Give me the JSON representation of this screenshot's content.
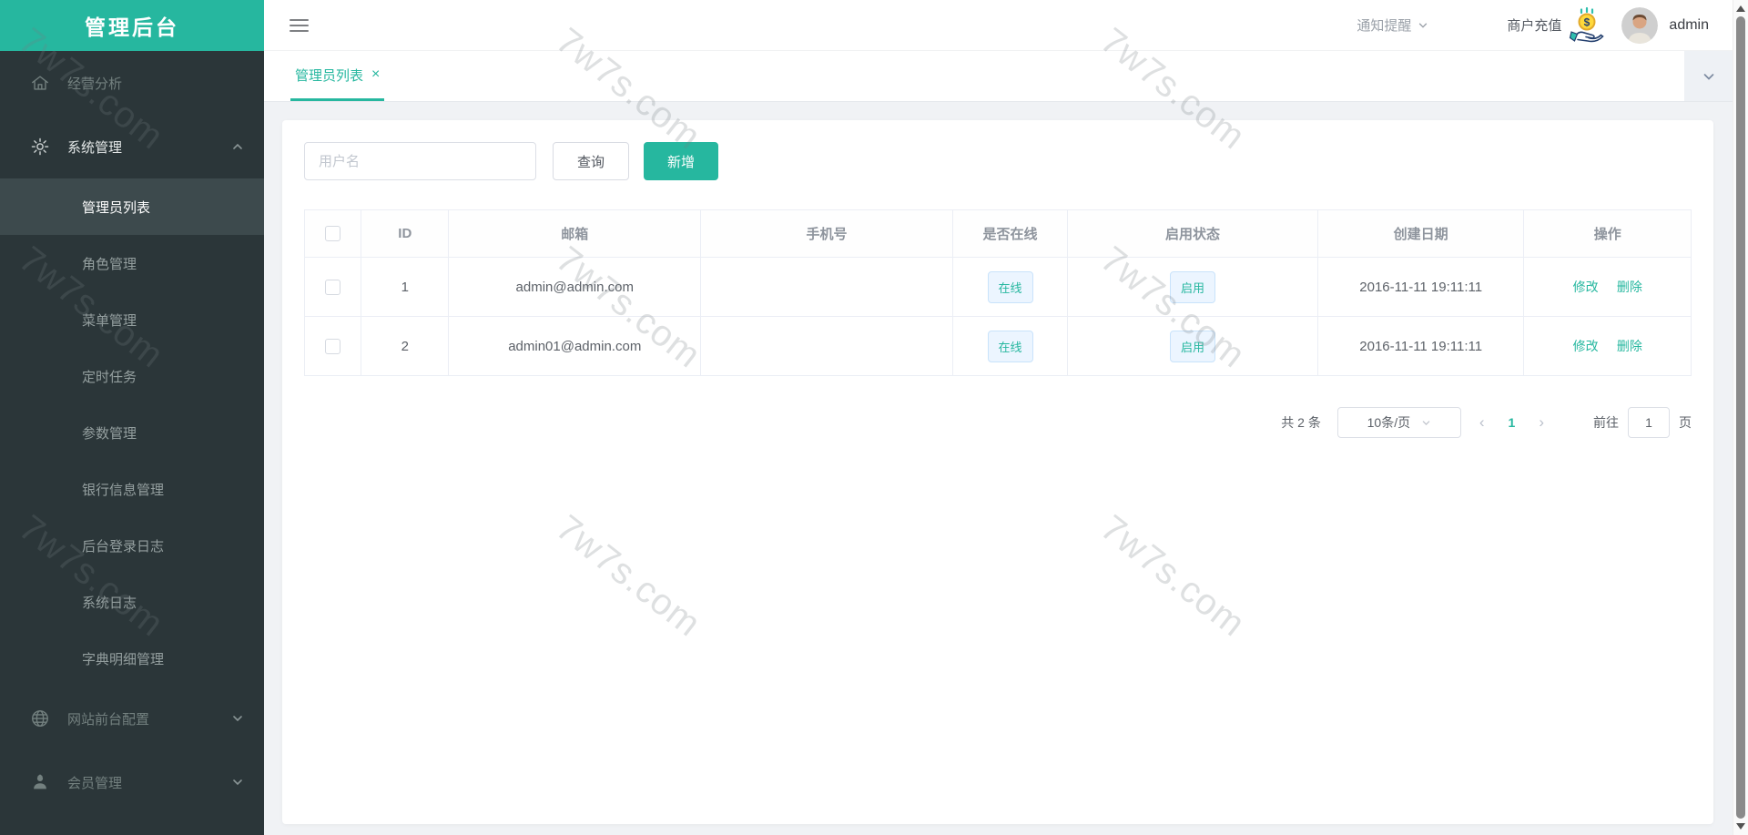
{
  "app": {
    "title": "管理后台"
  },
  "header": {
    "notice_label": "通知提醒",
    "recharge_label": "商户充值",
    "username": "admin"
  },
  "sidebar": {
    "items": [
      {
        "label": "经营分析",
        "icon": "home-icon"
      },
      {
        "label": "系统管理",
        "icon": "gear-icon",
        "expanded": true,
        "children": [
          {
            "label": "管理员列表",
            "active": true
          },
          {
            "label": "角色管理"
          },
          {
            "label": "菜单管理"
          },
          {
            "label": "定时任务"
          },
          {
            "label": "参数管理"
          },
          {
            "label": "银行信息管理"
          },
          {
            "label": "后台登录日志"
          },
          {
            "label": "系统日志"
          },
          {
            "label": "字典明细管理"
          }
        ]
      },
      {
        "label": "网站前台配置",
        "icon": "globe-icon",
        "expanded": false
      },
      {
        "label": "会员管理",
        "icon": "member-icon",
        "expanded": false
      }
    ]
  },
  "tabs": {
    "active_label": "管理员列表",
    "close_glyph": "×"
  },
  "toolbar": {
    "search_placeholder": "用户名",
    "search_value": "",
    "query_label": "查询",
    "add_label": "新增"
  },
  "table": {
    "headers": [
      "ID",
      "邮箱",
      "手机号",
      "是否在线",
      "启用状态",
      "创建日期",
      "操作"
    ],
    "rows": [
      {
        "id": "1",
        "email": "admin@admin.com",
        "phone": "",
        "online_label": "在线",
        "status_label": "启用",
        "created": "2016-11-11 19:11:11",
        "edit_label": "修改",
        "delete_label": "删除"
      },
      {
        "id": "2",
        "email": "admin01@admin.com",
        "phone": "",
        "online_label": "在线",
        "status_label": "启用",
        "created": "2016-11-11 19:11:11",
        "edit_label": "修改",
        "delete_label": "删除"
      }
    ]
  },
  "pagination": {
    "total_label": "共 2 条",
    "page_size": "10条/页",
    "current_page": "1",
    "goto_label": "前往",
    "goto_value": "1",
    "page_unit": "页"
  },
  "watermark": {
    "text": "7w7s.com"
  },
  "colors": {
    "accent": "#26b79f",
    "sidebar_bg": "#2b3639",
    "sidebar_active_bg": "#3d4a4d",
    "badge_bg": "#ecf5ff",
    "badge_border": "#c9e3fb",
    "content_bg": "#f0f2f5"
  }
}
